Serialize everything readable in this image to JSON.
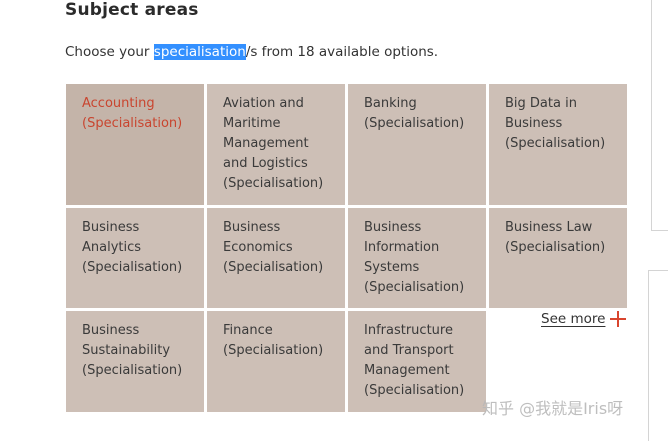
{
  "section": {
    "title": "Subject areas",
    "intro_before": "Choose your ",
    "intro_highlight": "specialisation",
    "intro_after": "/s from 18 available options."
  },
  "tiles": [
    {
      "name": "Accounting",
      "suffix": "(Specialisation)",
      "active": true
    },
    {
      "name": "Aviation and Maritime Management and Logistics",
      "suffix": "(Specialisation)"
    },
    {
      "name": "Banking",
      "suffix": "(Specialisation)"
    },
    {
      "name": "Big Data in Business",
      "suffix": "(Specialisation)"
    },
    {
      "name": "Business Analytics",
      "suffix": "(Specialisation)"
    },
    {
      "name": "Business Economics",
      "suffix": "(Specialisation)"
    },
    {
      "name": "Business Information Systems",
      "suffix": "(Specialisation)"
    },
    {
      "name": "Business Law",
      "suffix": "(Specialisation)"
    },
    {
      "name": "Business Sustainability",
      "suffix": "(Specialisation)"
    },
    {
      "name": "Finance",
      "suffix": "(Specialisation)"
    },
    {
      "name": "Infrastructure and Transport Management",
      "suffix": "(Specialisation)"
    }
  ],
  "see_more": {
    "label": "See more",
    "icon": "plus-icon"
  },
  "watermark": "知乎 @我就是Iris呀",
  "colors": {
    "tile_bg": "#cdbfb6",
    "tile_active_bg": "#c4b4a9",
    "accent": "#c9452f",
    "plus": "#d9452e",
    "highlight": "#3390ff"
  }
}
